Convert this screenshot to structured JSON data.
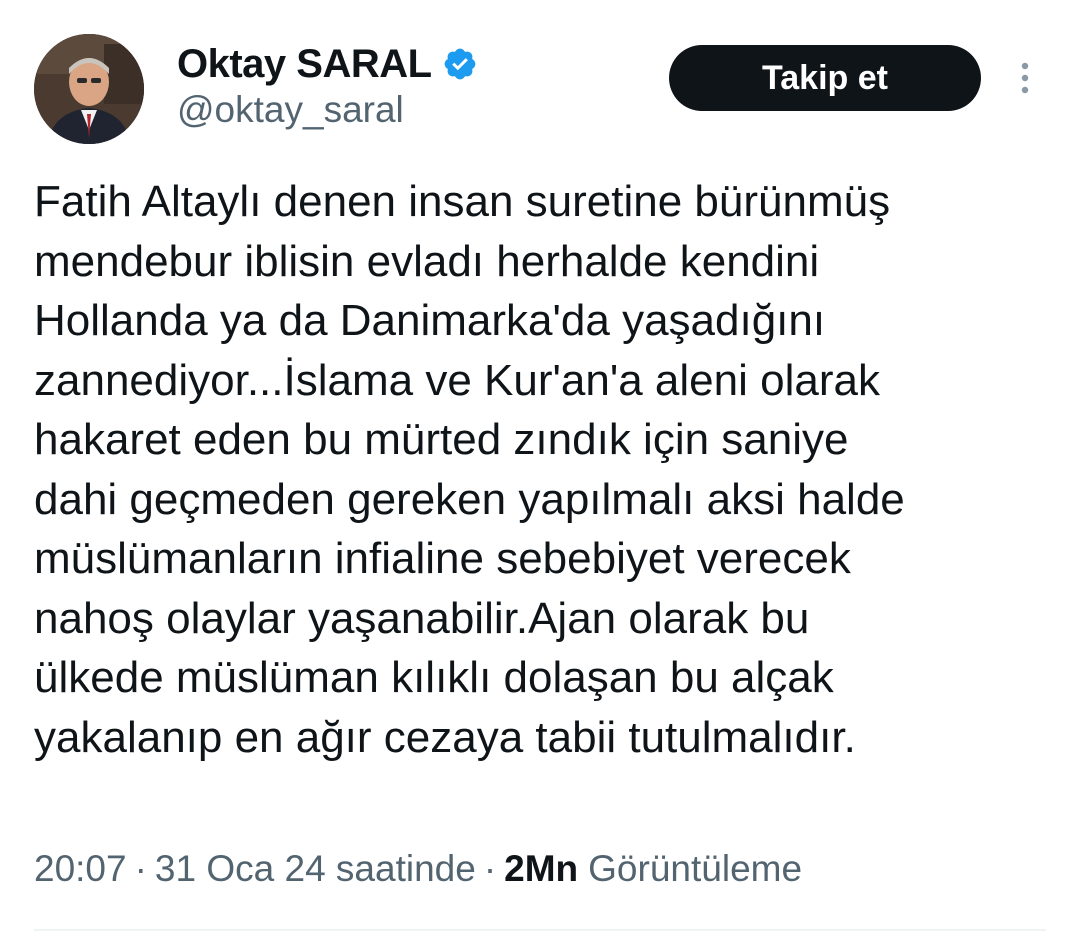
{
  "user": {
    "display_name": "Oktay SARAL",
    "handle": "@oktay_saral",
    "verified_color": "#1d9bf0"
  },
  "actions": {
    "follow_label": "Takip et"
  },
  "tweet": {
    "lines": [
      "Fatih Altaylı denen insan suretine bürünmüş",
      "mendebur iblisin evladı herhalde kendini",
      "Hollanda ya da Danimarka'da yaşadığını",
      "zannediyor...İslama ve Kur'an'a aleni olarak",
      "hakaret eden bu mürted zındık için saniye",
      "dahi geçmeden gereken yapılmalı aksi halde",
      "müslümanların infialine sebebiyet verecek",
      "nahoş olaylar yaşanabilir.Ajan olarak bu",
      "ülkede müslüman kılıklı dolaşan bu alçak",
      "yakalanıp en ağır cezaya tabii tutulmalıdır."
    ]
  },
  "meta": {
    "time": "20:07",
    "separator": "·",
    "date": "31 Oca 24 saatinde",
    "views_count": "2Mn",
    "views_label": "Görüntüleme"
  },
  "icons": {
    "verified": "verified-badge-icon",
    "more": "more-vertical-icon"
  }
}
